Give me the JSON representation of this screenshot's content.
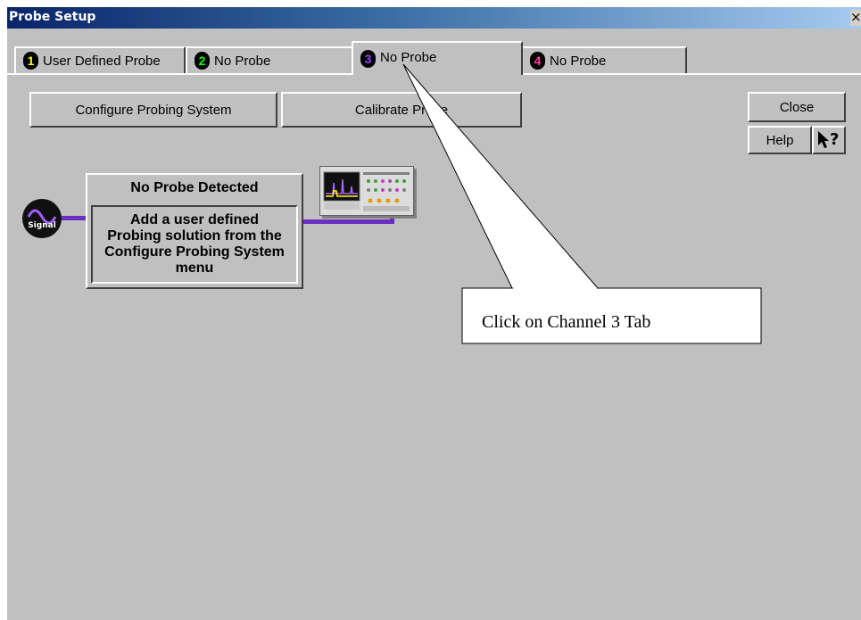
{
  "window": {
    "title": "Probe Setup",
    "close_glyph": "×"
  },
  "tabs": [
    {
      "number": "1",
      "label": "User Defined Probe",
      "color": "#ffff00"
    },
    {
      "number": "2",
      "label": "No Probe",
      "color": "#00ff00"
    },
    {
      "number": "3",
      "label": "No Probe",
      "color": "#9a40ff"
    },
    {
      "number": "4",
      "label": "No Probe",
      "color": "#ff40a0"
    }
  ],
  "active_tab": "3",
  "buttons": {
    "configure": "Configure Probing System",
    "calibrate": "Calibrate Probe",
    "close": "Close",
    "help": "Help",
    "whats_this": "?"
  },
  "diagram": {
    "signal_label": "Signal",
    "probe_title": "No Probe Detected",
    "probe_message": "Add a user defined Probing solution from the Configure Probing System menu"
  },
  "annotation": {
    "callout": "Click on Channel 3 Tab"
  }
}
